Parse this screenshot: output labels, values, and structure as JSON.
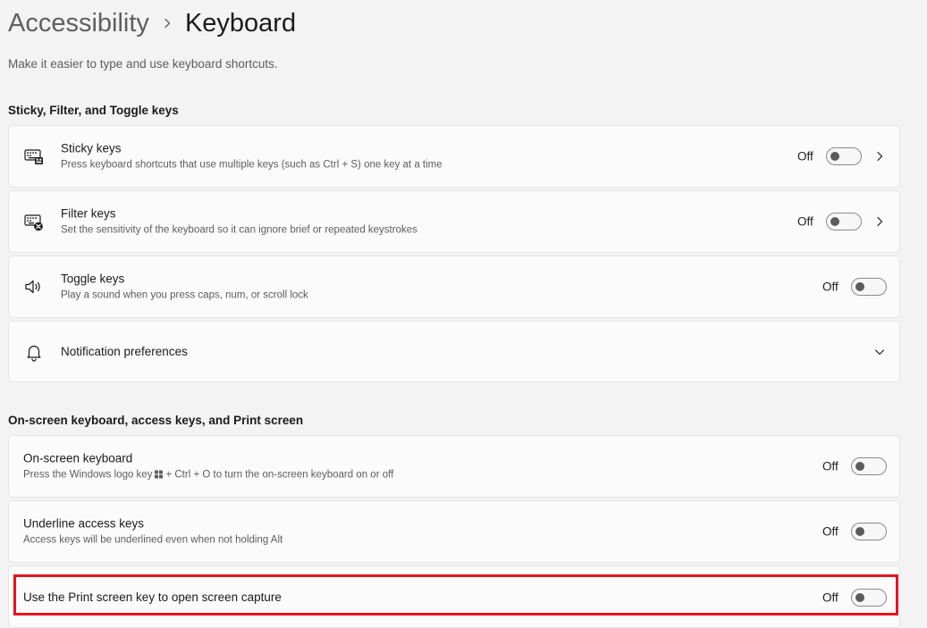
{
  "breadcrumb": {
    "parent": "Accessibility",
    "current": "Keyboard"
  },
  "page_description": "Make it easier to type and use keyboard shortcuts.",
  "sections": {
    "sticky": {
      "title": "Sticky, Filter, and Toggle keys",
      "items": [
        {
          "title": "Sticky keys",
          "subtitle": "Press keyboard shortcuts that use multiple keys (such as Ctrl + S) one key at a time",
          "toggle_label": "Off",
          "icon": "keyboard-sticky-icon",
          "has_chevron": true
        },
        {
          "title": "Filter keys",
          "subtitle": "Set the sensitivity of the keyboard so it can ignore brief or repeated keystrokes",
          "toggle_label": "Off",
          "icon": "keyboard-filter-icon",
          "has_chevron": true
        },
        {
          "title": "Toggle keys",
          "subtitle": "Play a sound when you press caps, num, or scroll lock",
          "toggle_label": "Off",
          "icon": "speaker-icon"
        },
        {
          "title": "Notification preferences",
          "icon": "bell-icon",
          "expandable": true
        }
      ]
    },
    "onscreen": {
      "title": "On-screen keyboard, access keys, and Print screen",
      "items": [
        {
          "title": "On-screen keyboard",
          "subtitle_before": "Press the Windows logo key",
          "subtitle_after": "+ Ctrl + O to turn the on-screen keyboard on or off",
          "toggle_label": "Off"
        },
        {
          "title": "Underline access keys",
          "subtitle": "Access keys will be underlined even when not holding Alt",
          "toggle_label": "Off"
        },
        {
          "title": "Use the Print screen key to open screen capture",
          "toggle_label": "Off"
        }
      ]
    }
  },
  "toggles_on": [
    false,
    false,
    false,
    false,
    false,
    false
  ],
  "colors": {
    "background": "#f3f3f3",
    "card": "#fbfbfb",
    "highlight": "#e3151f"
  }
}
